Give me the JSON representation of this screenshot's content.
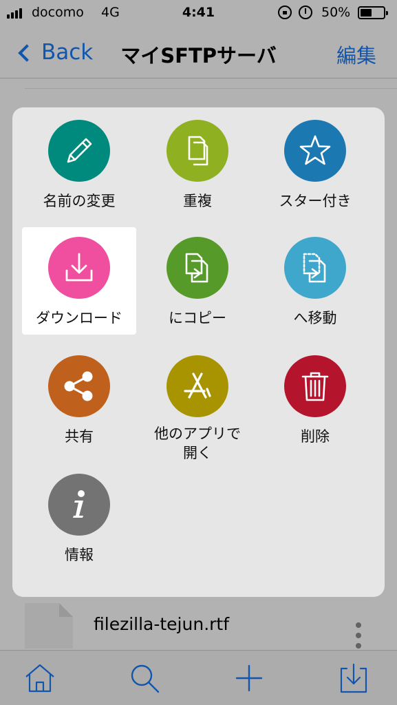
{
  "status": {
    "carrier": "docomo",
    "network": "4G",
    "time": "4:41",
    "battery_percent": "50%",
    "battery_level": 0.5
  },
  "nav": {
    "back_label": "Back",
    "title": "マイSFTPサーバ",
    "edit_label": "編集"
  },
  "file_row": {
    "name": "filezilla-tejun.rtf"
  },
  "actions": [
    {
      "label": "名前の変更",
      "icon": "pencil-icon",
      "color": "#008a7d"
    },
    {
      "label": "重複",
      "icon": "duplicate-icon",
      "color": "#8fb020"
    },
    {
      "label": "スター付き",
      "icon": "star-icon",
      "color": "#1b78b0"
    },
    {
      "label": "ダウンロード",
      "icon": "download-icon",
      "color": "#ef4f9e",
      "selected": true
    },
    {
      "label": "にコピー",
      "icon": "copy-to-icon",
      "color": "#569a2a"
    },
    {
      "label": "へ移動",
      "icon": "move-to-icon",
      "color": "#3fa6cc"
    },
    {
      "label": "共有",
      "icon": "share-icon",
      "color": "#c0601d"
    },
    {
      "label": "他のアプリで開く",
      "label_line1": "他のアプリで",
      "label_line2": "開く",
      "icon": "app-store-icon",
      "color": "#a89400"
    },
    {
      "label": "削除",
      "icon": "trash-icon",
      "color": "#b5142d"
    },
    {
      "label": "情報",
      "icon": "info-icon",
      "color": "#737373"
    }
  ],
  "tabs": [
    {
      "icon": "home-icon"
    },
    {
      "icon": "search-icon"
    },
    {
      "icon": "plus-icon"
    },
    {
      "icon": "inbox-download-icon"
    }
  ],
  "colors": {
    "accent": "#1a7cf5"
  }
}
